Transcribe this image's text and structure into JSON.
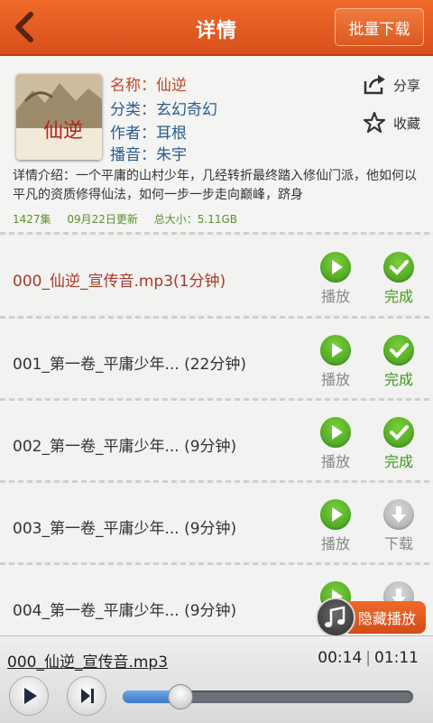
{
  "header": {
    "title": "详情",
    "batch_download": "批量下载"
  },
  "book": {
    "name_label": "名称：",
    "name": "仙逆",
    "category_label": "分类：",
    "category": "玄幻奇幻",
    "author_label": "作者：",
    "author": "耳根",
    "narrator_label": "播音：",
    "narrator": "朱宇",
    "cover_text": "仙逆",
    "description": "详情介绍：一个平庸的山村少年，几经转折最终踏入修仙门派，他如何以平凡的资质修得仙法，如何一步一步走向巅峰，跻身",
    "episodes": "1427集",
    "updated": "09月22日更新",
    "size": "总大小：5.11GB"
  },
  "actions": {
    "share": "分享",
    "favorite": "收藏"
  },
  "episodes": [
    {
      "title": "000_仙逆_宣传音.mp3(1分钟)",
      "play": "播放",
      "status": "完成",
      "status_type": "done"
    },
    {
      "title": "001_第一卷_平庸少年... (22分钟)",
      "play": "播放",
      "status": "完成",
      "status_type": "done"
    },
    {
      "title": "002_第一卷_平庸少年... (9分钟)",
      "play": "播放",
      "status": "完成",
      "status_type": "done"
    },
    {
      "title": "003_第一卷_平庸少年... (9分钟)",
      "play": "播放",
      "status": "下载",
      "status_type": "download"
    },
    {
      "title": "004_第一卷_平庸少年... (9分钟)",
      "play": "播放",
      "status": "下载",
      "status_type": "download"
    }
  ],
  "hide_player": "隐藏播放",
  "player": {
    "track": "000_仙逆_宣传音.mp3",
    "current_time": "00:14",
    "total_time": "01:11",
    "progress": 0.2
  },
  "colors": {
    "accent": "#e35f22",
    "green": "#4aa321"
  }
}
